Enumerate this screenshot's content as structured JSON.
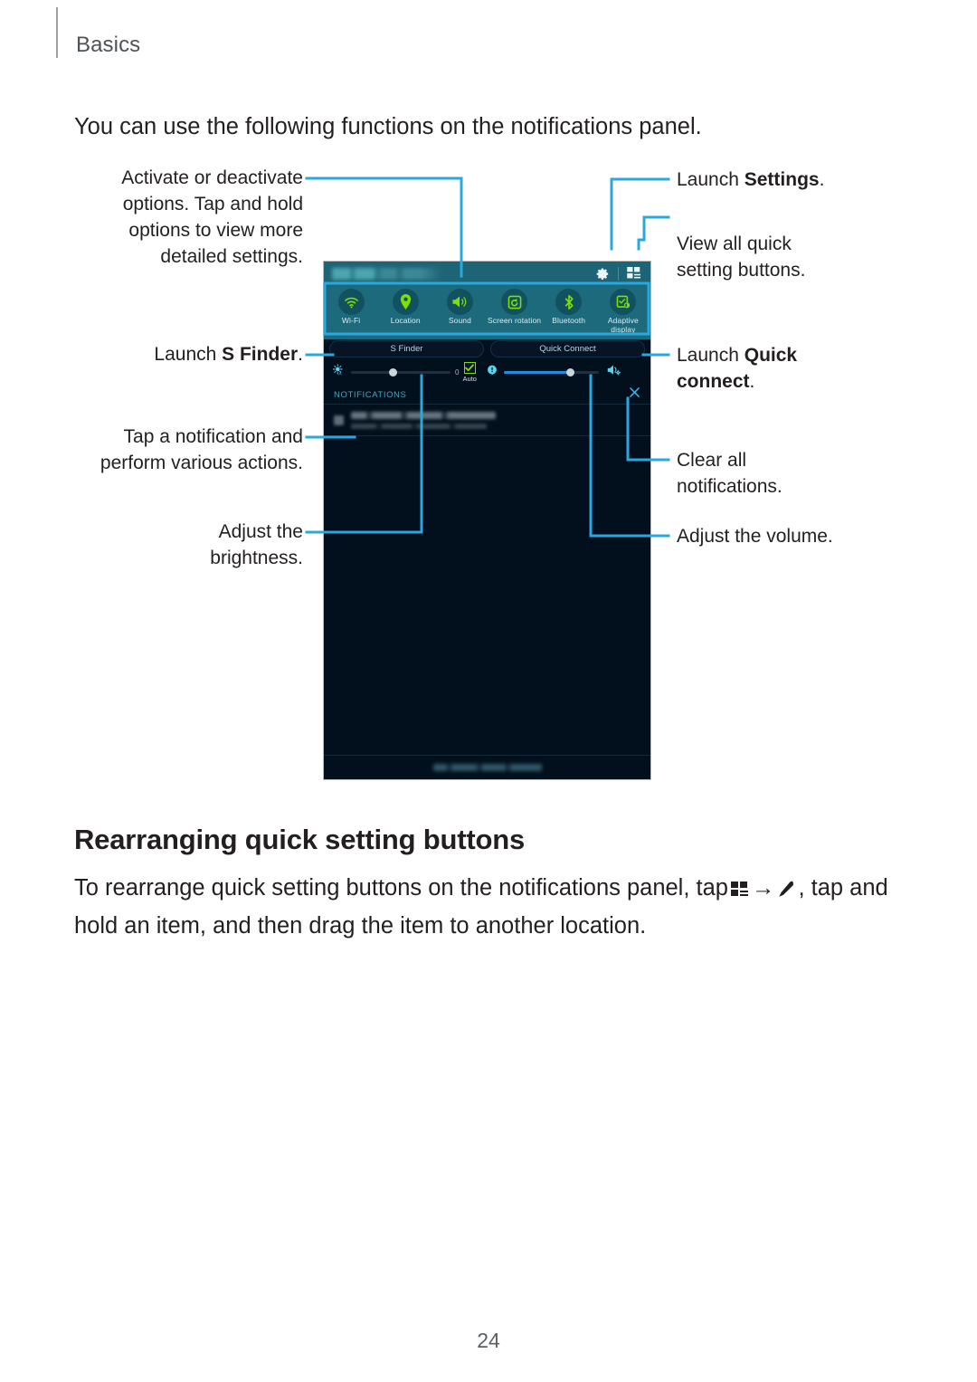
{
  "document": {
    "breadcrumb": "Basics",
    "page_number": "24"
  },
  "intro": {
    "text": "You can use the following functions on the notifications panel."
  },
  "annotations": {
    "activate": "Activate or deactivate options. Tap and hold options to view more detailed settings.",
    "s_finder_prefix": "Launch ",
    "s_finder_bold": "S Finder",
    "s_finder_suffix": ".",
    "tap_notification": "Tap a notification and perform various actions.",
    "adjust_brightness": "Adjust the brightness.",
    "launch_settings_prefix": "Launch ",
    "launch_settings_bold": "Settings",
    "launch_settings_suffix": ".",
    "view_all_quick": "View all quick setting buttons.",
    "quick_connect_prefix": "Launch ",
    "quick_connect_bold": "Quick connect",
    "quick_connect_suffix": ".",
    "clear_all": "Clear all notifications.",
    "adjust_volume": "Adjust the volume."
  },
  "device": {
    "status_bar": {
      "settings_icon": "gear-icon",
      "grid_icon": "quick-settings-grid-icon"
    },
    "quick_settings": [
      {
        "label": "Wi-Fi",
        "icon": "wifi-icon"
      },
      {
        "label": "Location",
        "icon": "location-pin-icon"
      },
      {
        "label": "Sound",
        "icon": "speaker-icon"
      },
      {
        "label": "Screen rotation",
        "icon": "screen-rotation-icon"
      },
      {
        "label": "Bluetooth",
        "icon": "bluetooth-icon"
      },
      {
        "label": "Adaptive display",
        "icon": "adaptive-display-icon"
      }
    ],
    "pills": [
      {
        "label": "S Finder"
      },
      {
        "label": "Quick Connect"
      }
    ],
    "brightness": {
      "icon": "brightness-auto-icon",
      "value": "0",
      "auto_label": "Auto",
      "fill_percent": 42
    },
    "volume": {
      "icon": "notification-volume-icon",
      "settings_icon": "volume-settings-icon",
      "fill_percent": 70
    },
    "notifications": {
      "header": "NOTIFICATIONS",
      "clear_icon": "close-x-icon"
    }
  },
  "section": {
    "heading": "Rearranging quick setting buttons",
    "body_part1": "To rearrange quick setting buttons on the notifications panel, tap",
    "body_arrow": "→",
    "body_part2": ", tap and hold an item, and then drag the item to another location.",
    "grid_icon": "quick-settings-grid-icon",
    "edit_icon": "pencil-edit-icon"
  },
  "colors": {
    "callout": "#29a8df",
    "breadcrumb": "#4e5357",
    "panel_teal": "#1d6a7d",
    "panel_dark": "#020f1c",
    "accent_green": "#7de000",
    "slider_blue": "#1e8ce0"
  }
}
